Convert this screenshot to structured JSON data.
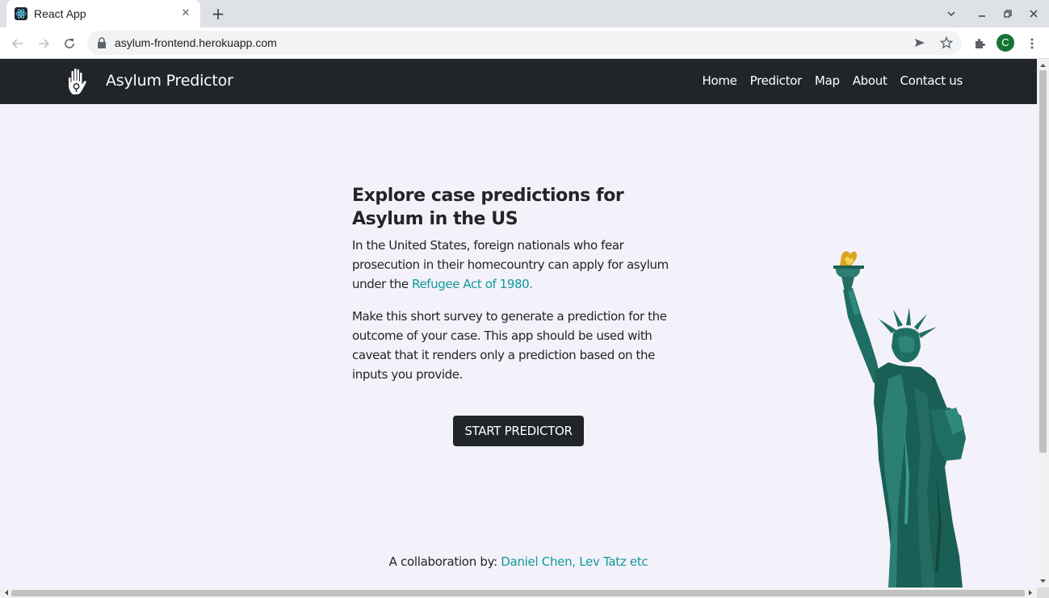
{
  "browser": {
    "tab_title": "React App",
    "url": "asylum-frontend.herokuapp.com",
    "profile_initial": "C"
  },
  "navbar": {
    "brand": "Asylum Predictor",
    "links": [
      "Home",
      "Predictor",
      "Map",
      "About",
      "Contact us"
    ]
  },
  "main": {
    "heading": "Explore case predictions for Asylum in the US",
    "para1_text": "In the United States, foreign nationals who fear prosecution in their homecountry can apply for asylum under the ",
    "para1_link": "Refugee Act of 1980.",
    "para2": "Make this short survey to generate a prediction for the outcome of your case. This app should be used with caveat that it renders only a prediction based on the inputs you provide.",
    "button": "START PREDICTOR"
  },
  "footer": {
    "prefix": "A collaboration by: ",
    "link": "Daniel Chen, Lev Tatz etc"
  },
  "colors": {
    "navbar_bg": "#212529",
    "page_bg": "#f3f1fa",
    "link": "#0f9a9a",
    "statue": "#1f6e63"
  },
  "icons": [
    "react-favicon",
    "close-icon",
    "plus-icon",
    "back-icon",
    "forward-icon",
    "reload-icon",
    "lock-icon",
    "send-icon",
    "star-icon",
    "extensions-icon",
    "menu-icon",
    "hand-logo-icon"
  ]
}
